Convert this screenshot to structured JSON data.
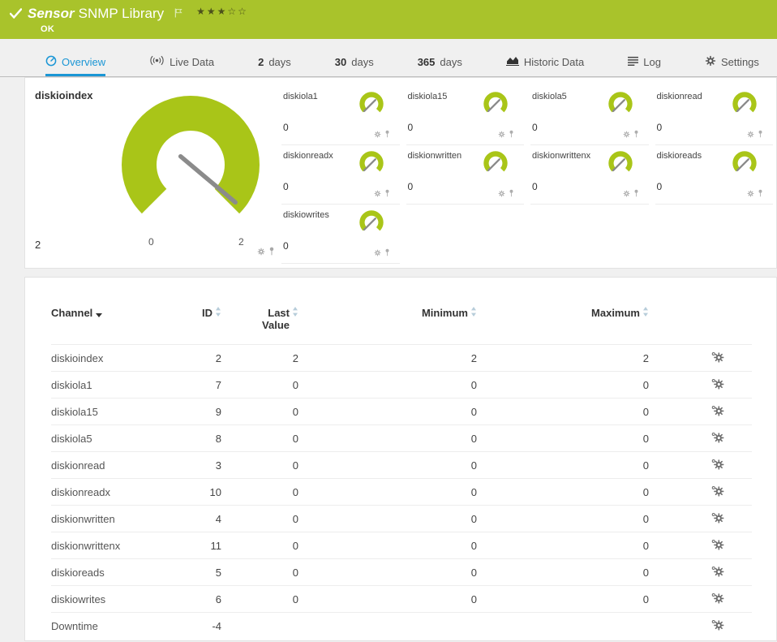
{
  "colors": {
    "accent_green": "#a9c32b",
    "gauge_green": "#a9c518",
    "accent_blue": "#1a96d5"
  },
  "header": {
    "title_prefix": "Sensor",
    "title": "SNMP Library",
    "status": "OK",
    "rating": {
      "stars_display": "★★★☆☆",
      "filled": 3,
      "total": 5
    }
  },
  "tabs": [
    {
      "label": "Overview",
      "icon": "gauge-icon",
      "active": true
    },
    {
      "label": "Live Data",
      "icon": "broadcast-icon",
      "active": false
    },
    {
      "num": "2",
      "label": "days",
      "active": false
    },
    {
      "num": "30",
      "label": "days",
      "active": false
    },
    {
      "num": "365",
      "label": "days",
      "active": false
    },
    {
      "label": "Historic Data",
      "icon": "area-chart-icon",
      "active": false
    },
    {
      "label": "Log",
      "icon": "log-icon",
      "active": false
    },
    {
      "label": "Settings",
      "icon": "gear-icon",
      "active": false
    }
  ],
  "gauges": {
    "main": {
      "label": "diskioindex",
      "value": "2",
      "scale_min": "0",
      "scale_max": "2"
    },
    "small": [
      {
        "label": "diskiola1",
        "value": "0"
      },
      {
        "label": "diskiola15",
        "value": "0"
      },
      {
        "label": "diskiola5",
        "value": "0"
      },
      {
        "label": "diskionread",
        "value": "0"
      },
      {
        "label": "diskionreadx",
        "value": "0"
      },
      {
        "label": "diskionwritten",
        "value": "0"
      },
      {
        "label": "diskionwrittenx",
        "value": "0"
      },
      {
        "label": "diskioreads",
        "value": "0"
      },
      {
        "label": "diskiowrites",
        "value": "0"
      }
    ]
  },
  "table": {
    "columns": {
      "channel": "Channel",
      "id": "ID",
      "last_value": "Last Value",
      "minimum": "Minimum",
      "maximum": "Maximum"
    },
    "rows": [
      {
        "channel": "diskioindex",
        "id": "2",
        "last": "2",
        "min": "2",
        "max": "2"
      },
      {
        "channel": "diskiola1",
        "id": "7",
        "last": "0",
        "min": "0",
        "max": "0"
      },
      {
        "channel": "diskiola15",
        "id": "9",
        "last": "0",
        "min": "0",
        "max": "0"
      },
      {
        "channel": "diskiola5",
        "id": "8",
        "last": "0",
        "min": "0",
        "max": "0"
      },
      {
        "channel": "diskionread",
        "id": "3",
        "last": "0",
        "min": "0",
        "max": "0"
      },
      {
        "channel": "diskionreadx",
        "id": "10",
        "last": "0",
        "min": "0",
        "max": "0"
      },
      {
        "channel": "diskionwritten",
        "id": "4",
        "last": "0",
        "min": "0",
        "max": "0"
      },
      {
        "channel": "diskionwrittenx",
        "id": "11",
        "last": "0",
        "min": "0",
        "max": "0"
      },
      {
        "channel": "diskioreads",
        "id": "5",
        "last": "0",
        "min": "0",
        "max": "0"
      },
      {
        "channel": "diskiowrites",
        "id": "6",
        "last": "0",
        "min": "0",
        "max": "0"
      },
      {
        "channel": "Downtime",
        "id": "-4",
        "last": "",
        "min": "",
        "max": ""
      }
    ]
  }
}
